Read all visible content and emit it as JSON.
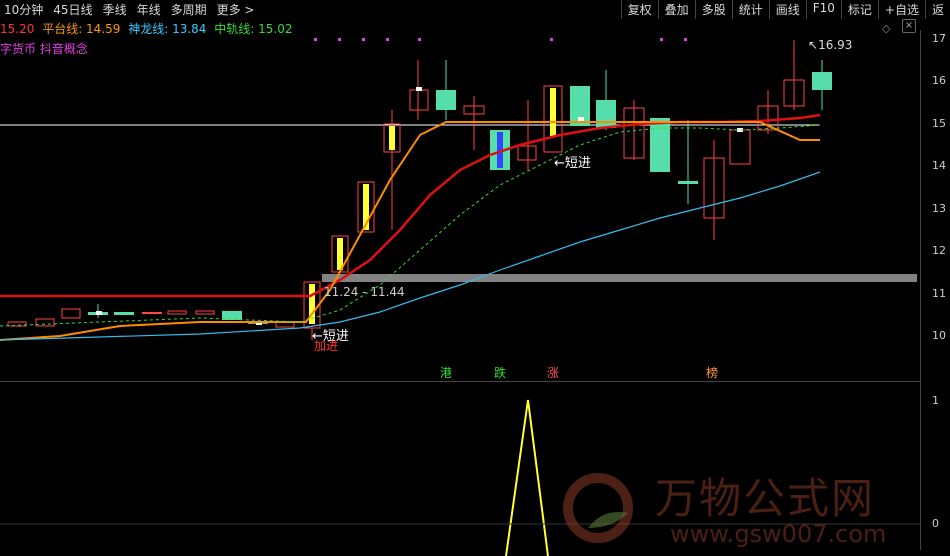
{
  "toolbar": {
    "left_items": [
      "10分钟",
      "45日线",
      "季线",
      "年线",
      "多周期",
      "更多 >"
    ],
    "right_items": [
      "复权",
      "叠加",
      "多股",
      "统计",
      "画线",
      "F10",
      "标记",
      "+自选",
      "返"
    ]
  },
  "indicators": {
    "first_value": "15.20",
    "platform_label": "平台线: 14.59",
    "dragon_label": "神龙线: 13.84",
    "mid_label": "中轨线: 15.02",
    "colors": {
      "first": "#ff3333",
      "platform": "#ff9900",
      "dragon": "#33ccff",
      "mid": "#33dd33"
    }
  },
  "concept_text": "字货币 抖音概念",
  "price_axis_labels": [
    "17",
    "16",
    "15",
    "14",
    "13",
    "12",
    "11",
    "10"
  ],
  "lower_axis_labels": [
    "1",
    "0"
  ],
  "annotations": {
    "high_label": "16.93",
    "short_label_1": "←短进",
    "short_label_2": "←短进",
    "add_label": "加进",
    "range_label": "11.24 - 11.44"
  },
  "event_tags": [
    {
      "text": "港",
      "color": "#33dd33"
    },
    {
      "text": "跌",
      "color": "#33dd33"
    },
    {
      "text": "涨",
      "color": "#ff5555"
    },
    {
      "text": "榜",
      "color": "#ff9933"
    }
  ],
  "watermark": {
    "line1": "万物公式网",
    "line2": "www.gsw007.com"
  },
  "close_icon_text": "×"
}
